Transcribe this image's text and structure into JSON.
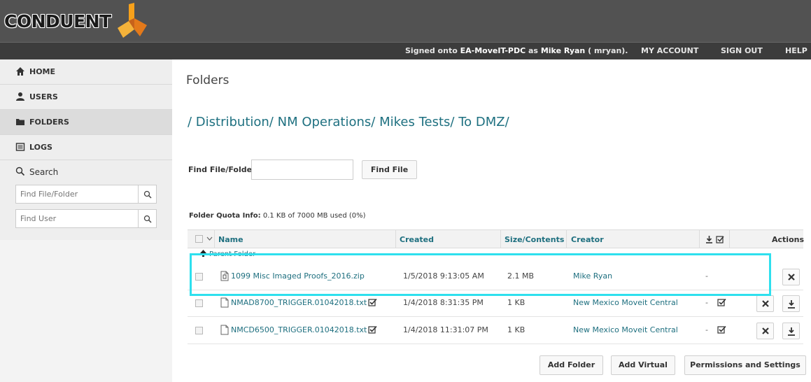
{
  "app": {
    "logo_text": "CONDUENT",
    "brand_colors": {
      "orange": "#f7a11a",
      "dark_orange": "#e3791a",
      "teal": "#1e6f7f",
      "highlight": "#2ee0ee"
    }
  },
  "header": {
    "signed_on_prefix": "Signed onto",
    "server": "EA-MoveIT-PDC",
    "as_text": "as",
    "user": "Mike Ryan",
    "username_suffix": "( mryan).",
    "my_account": "MY ACCOUNT",
    "sign_out": "SIGN OUT",
    "help": "HELP"
  },
  "sidebar": {
    "items": [
      {
        "label": "HOME",
        "icon": "home-icon"
      },
      {
        "label": "USERS",
        "icon": "user-icon"
      },
      {
        "label": "FOLDERS",
        "icon": "folder-icon",
        "active": true
      },
      {
        "label": "LOGS",
        "icon": "logs-icon"
      }
    ],
    "search": {
      "title": "Search",
      "file_placeholder": "Find File/Folder",
      "user_placeholder": "Find User"
    }
  },
  "main": {
    "title": "Folders",
    "breadcrumb": [
      "/ Distribution/",
      "NM Operations/",
      "Mikes Tests/",
      "To DMZ/"
    ],
    "find_label": "Find File/Folder:",
    "find_value": "",
    "find_button": "Find File",
    "quota_label": "Folder Quota Info:",
    "quota_value": "0.1 KB of 7000 MB used (0%)",
    "table": {
      "headers": {
        "name": "Name",
        "created": "Created",
        "size": "Size/Contents",
        "creator": "Creator",
        "actions": "Actions"
      },
      "parent_folder": "Parent Folder",
      "rows": [
        {
          "name": "1099 Misc Imaged Proofs_2016.zip",
          "created": "1/5/2018 9:13:05 AM",
          "size": "2.1 MB",
          "creator": "Mike Ryan",
          "download_flag": "-",
          "checked": false,
          "type": "zip-file-icon",
          "has_download": false
        },
        {
          "name": "NMAD8700_TRIGGER.01042018.txt",
          "created": "1/4/2018 8:31:35 PM",
          "size": "1 KB",
          "creator": "New Mexico Moveit Central",
          "download_flag": "-",
          "checked": true,
          "type": "file-icon",
          "has_download": true
        },
        {
          "name": "NMCD6500_TRIGGER.01042018.txt",
          "created": "1/4/2018 11:31:07 PM",
          "size": "1 KB",
          "creator": "New Mexico Moveit Central",
          "download_flag": "-",
          "checked": true,
          "type": "file-icon",
          "has_download": true
        }
      ]
    },
    "buttons": {
      "add_folder": "Add Folder",
      "add_virtual": "Add Virtual",
      "permissions": "Permissions and Settings"
    }
  }
}
